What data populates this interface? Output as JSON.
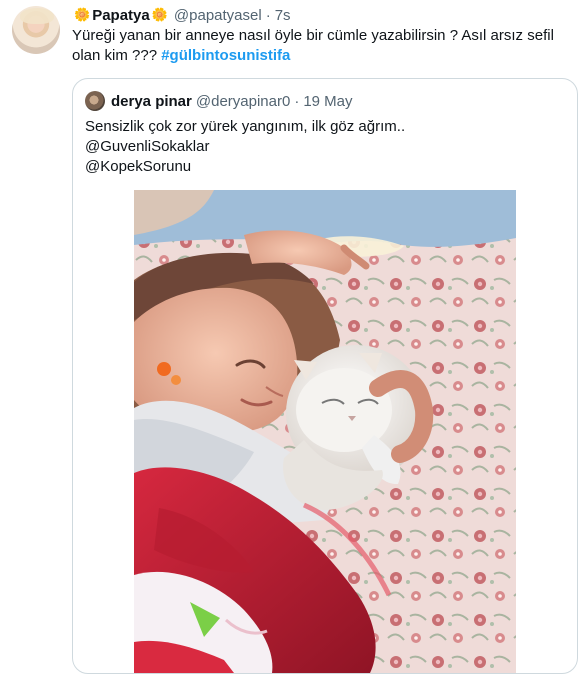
{
  "tweet": {
    "author_name": "Papatya",
    "author_handle": "@papatyasel",
    "separator": "·",
    "time": "7s",
    "flower_icon": "🌼",
    "text": "Yüreği yanan bir anneye nasıl öyle bir cümle yazabilirsin ? Asıl arsız sefil olan kim ??? ",
    "hashtag": "#gülbintosunistifa"
  },
  "quote": {
    "author_name": "derya pinar",
    "author_handle": "@deryapinar0",
    "separator": "·",
    "date": "19 May",
    "lines": [
      "Sensizlik çok zor yürek yangınım, ilk göz ağrım..",
      "@GuvenliSokaklar",
      "@KopekSorunu"
    ]
  },
  "colors": {
    "link": "#1d9bf0",
    "secondary_text": "#536471",
    "border": "#cfd9de"
  }
}
